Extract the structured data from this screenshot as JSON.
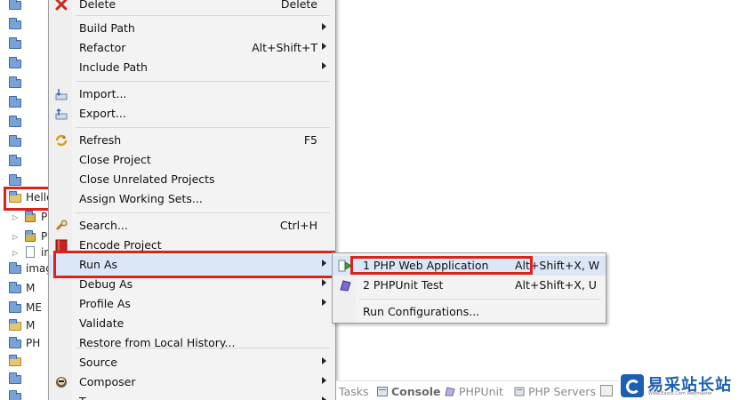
{
  "tree": {
    "selected_label": "Hello",
    "rows": [
      {
        "label": "",
        "kind": "folder"
      },
      {
        "label": "",
        "kind": "folder"
      },
      {
        "label": "",
        "kind": "folder"
      },
      {
        "label": "",
        "kind": "folder"
      },
      {
        "label": "",
        "kind": "folder"
      },
      {
        "label": "",
        "kind": "folder"
      },
      {
        "label": "",
        "kind": "folder"
      },
      {
        "label": "",
        "kind": "folder"
      },
      {
        "label": "",
        "kind": "folder"
      },
      {
        "label": "Hello",
        "kind": "project"
      },
      {
        "label": "P",
        "kind": "child"
      },
      {
        "label": "P",
        "kind": "child"
      },
      {
        "label": "in",
        "kind": "child"
      },
      {
        "label": "imag",
        "kind": "folder"
      },
      {
        "label": "M",
        "kind": "folder"
      },
      {
        "label": "ME",
        "kind": "folder"
      },
      {
        "label": "M",
        "kind": "project"
      },
      {
        "label": "PH",
        "kind": "folder"
      },
      {
        "label": "",
        "kind": "project"
      },
      {
        "label": "",
        "kind": "folder"
      }
    ]
  },
  "menu": {
    "items": [
      {
        "label": "Delete",
        "accel": "Delete",
        "icon": "delete-icon"
      },
      {
        "label": "Build Path",
        "submenu": true
      },
      {
        "label": "Refactor",
        "accel": "Alt+Shift+T",
        "submenu": true
      },
      {
        "label": "Include Path",
        "submenu": true
      },
      {
        "label": "Import...",
        "icon": "import-icon"
      },
      {
        "label": "Export...",
        "icon": "export-icon"
      },
      {
        "label": "Refresh",
        "accel": "F5",
        "icon": "refresh-icon"
      },
      {
        "label": "Close Project"
      },
      {
        "label": "Close Unrelated Projects"
      },
      {
        "label": "Assign Working Sets..."
      },
      {
        "label": "Search...",
        "accel": "Ctrl+H",
        "icon": "search-icon"
      },
      {
        "label": "Encode Project",
        "icon": "encode-icon"
      },
      {
        "label": "Run As",
        "submenu": true
      },
      {
        "label": "Debug As",
        "submenu": true
      },
      {
        "label": "Profile As",
        "submenu": true
      },
      {
        "label": "Validate"
      },
      {
        "label": "Restore from Local History..."
      },
      {
        "label": "Source",
        "submenu": true
      },
      {
        "label": "Composer",
        "submenu": true,
        "icon": "composer-icon"
      },
      {
        "label": "T",
        "submenu": true
      }
    ]
  },
  "submenu": {
    "items": [
      {
        "label": "1 PHP Web Application",
        "accel": "Alt+Shift+X, W",
        "icon": "run-web-icon"
      },
      {
        "label": "2 PHPUnit Test",
        "accel": "Alt+Shift+X, U",
        "icon": "phpunit-icon"
      },
      {
        "label": "Run Configurations..."
      }
    ]
  },
  "bottom_tabs": {
    "tasks": "Tasks",
    "console": "Console",
    "phpunit": "PHPUnit",
    "php_servers": "PHP Servers"
  },
  "watermark": {
    "title": "易采站长站",
    "subtitle": "Www.Easck.Com Webmaster"
  },
  "colors": {
    "highlight": "#e0201c",
    "menu_bg": "#f3f3f3",
    "selection": "#dbe6f6",
    "folder": "#7aa2d6"
  }
}
